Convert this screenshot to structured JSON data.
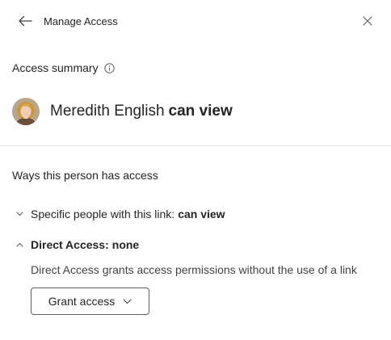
{
  "header": {
    "title": "Manage Access",
    "back_icon": "arrow-left-icon",
    "close_icon": "close-icon"
  },
  "summary": {
    "heading": "Access summary",
    "info_icon": "info-icon",
    "person": {
      "name": "Meredith English",
      "permission": "can view"
    }
  },
  "ways": {
    "heading": "Ways this person has access",
    "items": [
      {
        "label": "Specific people with this link:",
        "value": "can view",
        "expanded": false,
        "icon": "chevron-down-icon"
      },
      {
        "label": "Direct Access:",
        "value": "none",
        "expanded": true,
        "icon": "chevron-up-icon",
        "description": "Direct Access grants access permissions without the use of a link",
        "button_label": "Grant access"
      }
    ]
  },
  "colors": {
    "text": "#242424",
    "secondary_text": "#424242",
    "divider": "#e6e6e6",
    "button_border": "#616161"
  }
}
